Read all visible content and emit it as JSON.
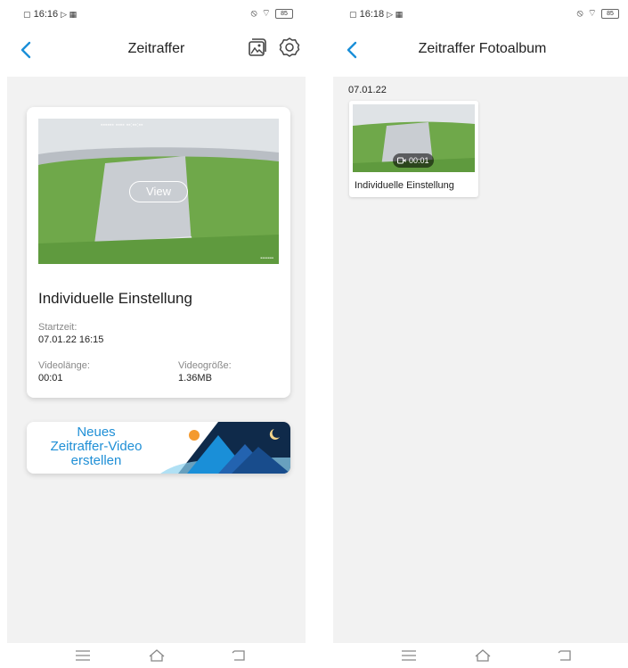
{
  "left": {
    "status": {
      "time": "16:16",
      "battery": "85"
    },
    "header": {
      "title": "Zeitraffer"
    },
    "card": {
      "view_label": "View",
      "title": "Individuelle Einstellung",
      "start_label": "Startzeit:",
      "start_value": "07.01.22 16:15",
      "length_label": "Videolänge:",
      "length_value": "00:01",
      "size_label": "Videogröße:",
      "size_value": "1.36MB"
    },
    "banner": {
      "line1": "Neues",
      "line2": "Zeitraffer-Video",
      "line3": "erstellen"
    }
  },
  "right": {
    "status": {
      "time": "16:18",
      "battery": "85"
    },
    "header": {
      "title": "Zeitraffer Fotoalbum"
    },
    "album": {
      "date": "07.01.22",
      "items": [
        {
          "duration": "00:01",
          "caption": "Individuelle Einstellung"
        }
      ]
    }
  },
  "colors": {
    "accent": "#1a8fd8",
    "bg": "#f2f2f2",
    "banner_dark": "#0f2a4a"
  }
}
